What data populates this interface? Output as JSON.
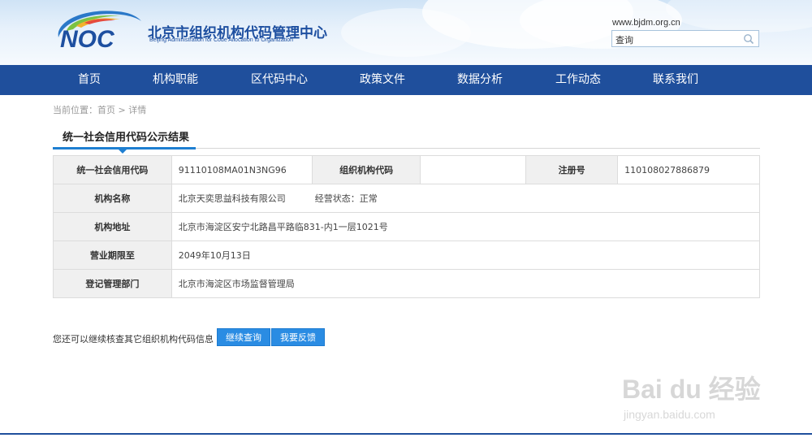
{
  "header": {
    "logo_text": "NOC",
    "org_name": "北京市组织机构代码管理中心",
    "org_name_en": "Beijing Administration for Code Allocation to Organization",
    "site_url": "www.bjdm.org.cn",
    "search_placeholder": "查询"
  },
  "nav": {
    "items": [
      {
        "label": "首页"
      },
      {
        "label": "机构职能"
      },
      {
        "label": "区代码中心"
      },
      {
        "label": "政策文件"
      },
      {
        "label": "数据分析"
      },
      {
        "label": "工作动态"
      },
      {
        "label": "联系我们"
      }
    ]
  },
  "breadcrumb": {
    "prefix": "当前位置：",
    "home": "首页",
    "separator": " > ",
    "current": "详情"
  },
  "section": {
    "title": "统一社会信用代码公示结果"
  },
  "record": {
    "credit_code_label": "统一社会信用代码",
    "credit_code_value": "91110108MA01N3NG96",
    "org_code_label": "组织机构代码",
    "org_code_value": "",
    "reg_no_label": "注册号",
    "reg_no_value": "110108027886879",
    "name_label": "机构名称",
    "name_value": "北京天奕思益科技有限公司",
    "status_label": "经营状态：",
    "status_value": "正常",
    "address_label": "机构地址",
    "address_value": "北京市海淀区安宁北路昌平路临831-内1一层1021号",
    "term_label": "营业期限至",
    "term_value": "2049年10月13日",
    "authority_label": "登记管理部门",
    "authority_value": "北京市海淀区市场监督管理局"
  },
  "footer": {
    "prompt": "您还可以继续核查其它组织机构代码信息",
    "continue_label": "继续查询",
    "feedback_label": "我要反馈"
  },
  "watermark": {
    "brand": "Bai du 经验",
    "url": "jingyan.baidu.com"
  }
}
